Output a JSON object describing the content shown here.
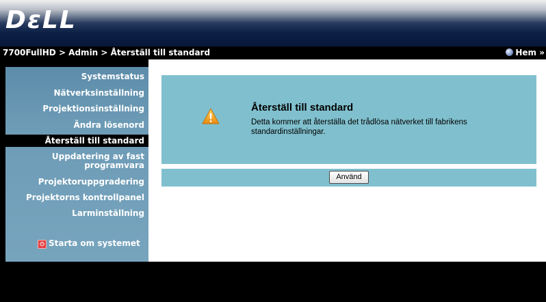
{
  "header": {
    "logo": "DεLL"
  },
  "navbar": {
    "breadcrumb": "7700FullHD > Admin > Återställ till standard",
    "home_label": "Hem »",
    "home_icon": "globe-icon"
  },
  "sidebar": {
    "items": [
      {
        "label": "Systemstatus"
      },
      {
        "label": "Nätverksinställning"
      },
      {
        "label": "Projektionsinställning"
      },
      {
        "label": "Ändra lösenord"
      },
      {
        "label": "Återställ till standard",
        "selected": true
      },
      {
        "label": "Uppdatering av fast programvara"
      },
      {
        "label": "Projektoruppgradering"
      },
      {
        "label": "Projektorns kontrollpanel"
      },
      {
        "label": "Larminställning"
      }
    ],
    "restart_label": "Starta om systemet",
    "restart_icon": "power-icon"
  },
  "main": {
    "title": "Återställ till standard",
    "description": "Detta kommer att återställa det trådlösa nätverket till fabrikens standardinställningar.",
    "warning_icon": "warning-icon",
    "apply_label": "Använd"
  },
  "colors": {
    "panel": "#80c0ce",
    "sidebar": "#6d9bb6",
    "selected": "#000000",
    "warning": "#f0a020"
  }
}
